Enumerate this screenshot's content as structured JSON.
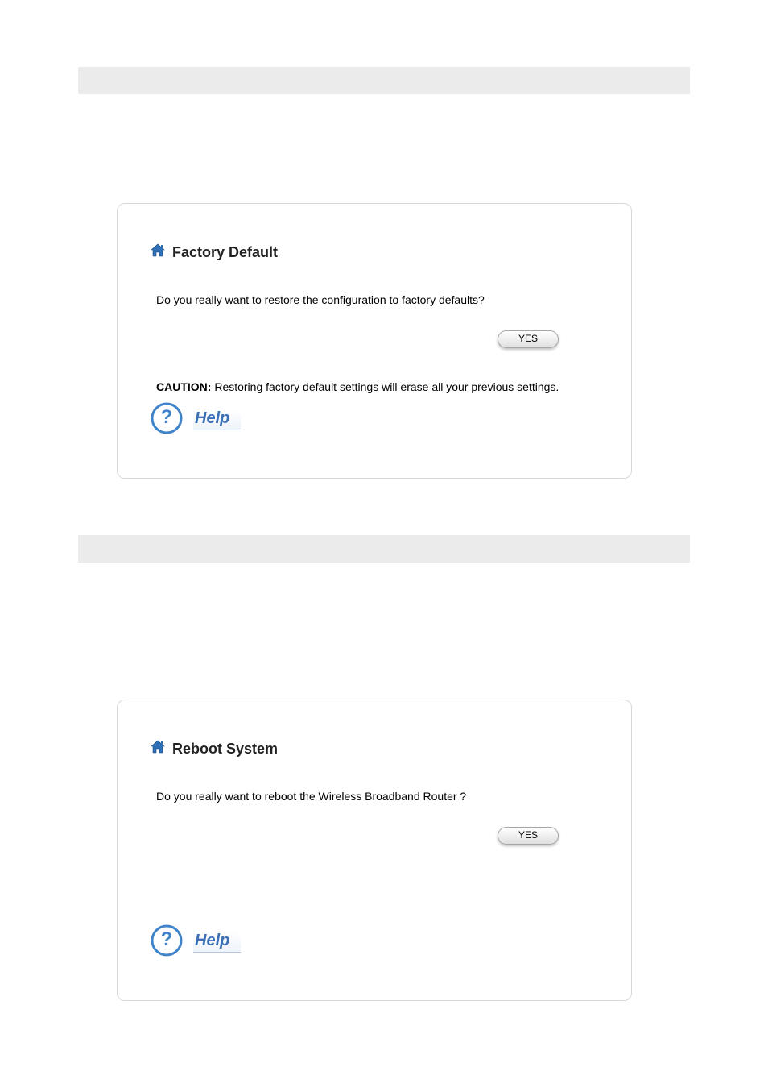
{
  "panels": {
    "factory": {
      "title": "Factory Default",
      "prompt": "Do you really want to restore the configuration to factory defaults?",
      "button": "YES",
      "caution_label": "CAUTION:",
      "caution_text": " Restoring factory default settings will erase all your previous settings.",
      "help": "Help"
    },
    "reboot": {
      "title": "Reboot System",
      "prompt": "Do you really want to reboot the Wireless Broadband Router ?",
      "button": "YES",
      "help": "Help"
    }
  }
}
